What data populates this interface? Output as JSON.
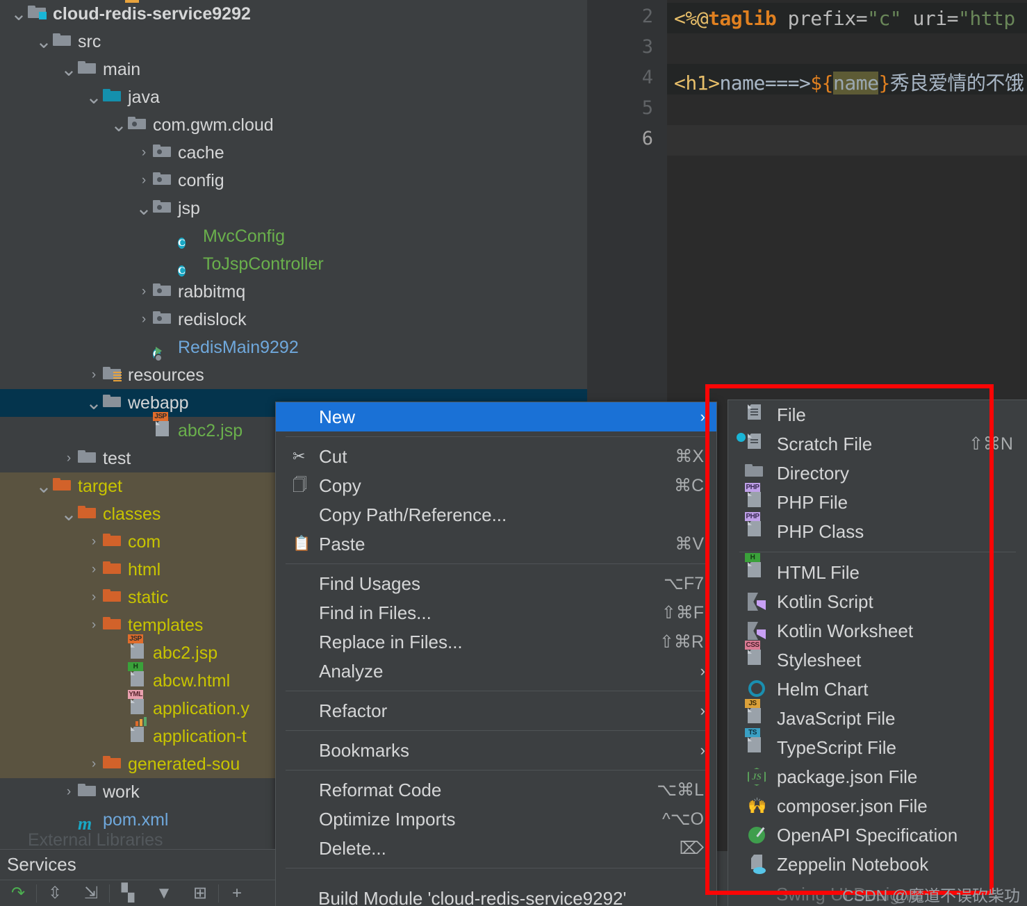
{
  "app": {
    "ide": "IntelliJ IDEA",
    "watermark": "CSDN @魔道不误砍柴功"
  },
  "colors": {
    "accent_selection": "#1a71d6",
    "tree_selected_row": "#04344d",
    "target_folder_bg": "#5a5340",
    "target_folder_text": "#c8c400",
    "annotation_red": "#fb0505",
    "panel_bg": "#3c3f41",
    "editor_bg": "#2b2b2b"
  },
  "project_tree": {
    "items": [
      {
        "label": "cloud-redis-service9292",
        "indent": 0,
        "twisty": "down",
        "icon": "module-folder-icon",
        "style": "bold"
      },
      {
        "label": "src",
        "indent": 1,
        "twisty": "down",
        "icon": "folder-grey-icon",
        "style": "normal"
      },
      {
        "label": "main",
        "indent": 2,
        "twisty": "down",
        "icon": "folder-grey-icon",
        "style": "normal"
      },
      {
        "label": "java",
        "indent": 3,
        "twisty": "down",
        "icon": "folder-blue-source-icon",
        "style": "normal"
      },
      {
        "label": "com.gwm.cloud",
        "indent": 4,
        "twisty": "down",
        "icon": "package-icon",
        "style": "normal"
      },
      {
        "label": "cache",
        "indent": 5,
        "twisty": "right",
        "icon": "package-icon",
        "style": "normal"
      },
      {
        "label": "config",
        "indent": 5,
        "twisty": "right",
        "icon": "package-icon",
        "style": "normal"
      },
      {
        "label": "jsp",
        "indent": 5,
        "twisty": "down",
        "icon": "package-icon",
        "style": "normal"
      },
      {
        "label": "MvcConfig",
        "indent": 6,
        "twisty": "none",
        "icon": "class-icon",
        "style": "green"
      },
      {
        "label": "ToJspController",
        "indent": 6,
        "twisty": "none",
        "icon": "class-icon",
        "style": "green"
      },
      {
        "label": "rabbitmq",
        "indent": 5,
        "twisty": "right",
        "icon": "package-icon",
        "style": "normal"
      },
      {
        "label": "redislock",
        "indent": 5,
        "twisty": "right",
        "icon": "package-icon",
        "style": "normal"
      },
      {
        "label": "RedisMain9292",
        "indent": 5,
        "twisty": "none",
        "icon": "runnable-class-icon",
        "style": "blue"
      },
      {
        "label": "resources",
        "indent": 3,
        "twisty": "right",
        "icon": "resources-folder-icon",
        "style": "normal"
      },
      {
        "label": "webapp",
        "indent": 3,
        "twisty": "down",
        "icon": "folder-grey-icon",
        "style": "normal",
        "selected": true
      },
      {
        "label": "abc2.jsp",
        "indent": 5,
        "twisty": "none",
        "icon": "jsp-file-icon",
        "style": "green"
      },
      {
        "label": "test",
        "indent": 2,
        "twisty": "right",
        "icon": "folder-grey-icon",
        "style": "normal"
      },
      {
        "label": "target",
        "indent": 1,
        "twisty": "down",
        "icon": "folder-orange-icon",
        "style": "excluded"
      },
      {
        "label": "classes",
        "indent": 2,
        "twisty": "down",
        "icon": "folder-orange-icon",
        "style": "excluded"
      },
      {
        "label": "com",
        "indent": 3,
        "twisty": "right",
        "icon": "folder-orange-icon",
        "style": "excluded"
      },
      {
        "label": "html",
        "indent": 3,
        "twisty": "right",
        "icon": "folder-orange-icon",
        "style": "excluded"
      },
      {
        "label": "static",
        "indent": 3,
        "twisty": "right",
        "icon": "folder-orange-icon",
        "style": "excluded"
      },
      {
        "label": "templates",
        "indent": 3,
        "twisty": "right",
        "icon": "folder-orange-icon",
        "style": "excluded"
      },
      {
        "label": "abc2.jsp",
        "indent": 4,
        "twisty": "none",
        "icon": "jsp-file-icon",
        "style": "excluded"
      },
      {
        "label": "abcw.html",
        "indent": 4,
        "twisty": "none",
        "icon": "html-file-icon",
        "style": "excluded"
      },
      {
        "label": "application.y",
        "indent": 4,
        "twisty": "none",
        "icon": "yml-file-icon",
        "style": "excluded"
      },
      {
        "label": "application-t",
        "indent": 4,
        "twisty": "none",
        "icon": "properties-file-icon",
        "style": "excluded"
      },
      {
        "label": "generated-sou",
        "indent": 3,
        "twisty": "right",
        "icon": "folder-orange-icon",
        "style": "excluded"
      },
      {
        "label": "work",
        "indent": 2,
        "twisty": "right",
        "icon": "folder-grey-icon",
        "style": "normal"
      },
      {
        "label": "pom.xml",
        "indent": 2,
        "twisty": "none",
        "icon": "maven-file-icon",
        "style": "blue"
      }
    ],
    "clipped_row": "External Libraries"
  },
  "editor": {
    "line_numbers": [
      "2",
      "3",
      "4",
      "5",
      "6"
    ],
    "current_line": "6",
    "lines": [
      {
        "n": "2",
        "tokens": [
          {
            "t": "<%@",
            "k": "tag"
          },
          {
            "t": "taglib",
            "k": "kw"
          },
          {
            "t": " prefix=",
            "k": "attr"
          },
          {
            "t": "\"c\"",
            "k": "str"
          },
          {
            "t": " uri=",
            "k": "attr"
          },
          {
            "t": "\"http",
            "k": "str"
          }
        ]
      },
      {
        "n": "4",
        "tokens": [
          {
            "t": "<h1>",
            "k": "tag"
          },
          {
            "t": "name===>",
            "k": "plain"
          },
          {
            "t": "${",
            "k": "el"
          },
          {
            "t": "name",
            "k": "elname"
          },
          {
            "t": "}",
            "k": "el"
          },
          {
            "t": "秀良爱情的不饿",
            "k": "cn"
          }
        ]
      }
    ]
  },
  "context_menu": {
    "items": [
      {
        "label": "New",
        "shortcut": "",
        "icon": "",
        "submenu": true,
        "highlighted": true
      },
      {
        "sep": true
      },
      {
        "label": "Cut",
        "shortcut": "⌘X",
        "icon": "scissors-icon"
      },
      {
        "label": "Copy",
        "shortcut": "⌘C",
        "icon": "copy-icon"
      },
      {
        "label": "Copy Path/Reference...",
        "shortcut": "",
        "icon": ""
      },
      {
        "label": "Paste",
        "shortcut": "⌘V",
        "icon": "clipboard-icon"
      },
      {
        "sep": true
      },
      {
        "label": "Find Usages",
        "shortcut": "⌥F7",
        "icon": ""
      },
      {
        "label": "Find in Files...",
        "shortcut": "⇧⌘F",
        "icon": ""
      },
      {
        "label": "Replace in Files...",
        "shortcut": "⇧⌘R",
        "icon": ""
      },
      {
        "label": "Analyze",
        "shortcut": "",
        "icon": "",
        "submenu": true
      },
      {
        "sep": true
      },
      {
        "label": "Refactor",
        "shortcut": "",
        "icon": "",
        "submenu": true
      },
      {
        "sep": true
      },
      {
        "label": "Bookmarks",
        "shortcut": "",
        "icon": "",
        "submenu": true
      },
      {
        "sep": true
      },
      {
        "label": "Reformat Code",
        "shortcut": "⌥⌘L",
        "icon": ""
      },
      {
        "label": "Optimize Imports",
        "shortcut": "^⌥O",
        "icon": ""
      },
      {
        "label": "Delete...",
        "shortcut": "⌦",
        "icon": ""
      },
      {
        "sep": true
      }
    ],
    "clipped_item": "Build Module 'cloud-redis-service9292'"
  },
  "new_submenu": {
    "items": [
      {
        "label": "File",
        "shortcut": "",
        "icon": "file-icon"
      },
      {
        "label": "Scratch File",
        "shortcut": "⇧⌘N",
        "icon": "scratch-file-icon"
      },
      {
        "label": "Directory",
        "shortcut": "",
        "icon": "directory-icon"
      },
      {
        "label": "PHP File",
        "shortcut": "",
        "icon": "php-file-icon"
      },
      {
        "label": "PHP Class",
        "shortcut": "",
        "icon": "php-class-icon"
      },
      {
        "sep": true
      },
      {
        "label": "HTML File",
        "shortcut": "",
        "icon": "html-file-icon"
      },
      {
        "label": "Kotlin Script",
        "shortcut": "",
        "icon": "kotlin-icon"
      },
      {
        "label": "Kotlin Worksheet",
        "shortcut": "",
        "icon": "kotlin-icon"
      },
      {
        "label": "Stylesheet",
        "shortcut": "",
        "icon": "css-file-icon"
      },
      {
        "label": "Helm Chart",
        "shortcut": "",
        "icon": "helm-chart-icon"
      },
      {
        "label": "JavaScript File",
        "shortcut": "",
        "icon": "javascript-file-icon"
      },
      {
        "label": "TypeScript File",
        "shortcut": "",
        "icon": "typescript-file-icon"
      },
      {
        "label": "package.json File",
        "shortcut": "",
        "icon": "nodejs-icon"
      },
      {
        "label": "composer.json File",
        "shortcut": "",
        "icon": "composer-icon"
      },
      {
        "label": "OpenAPI Specification",
        "shortcut": "",
        "icon": "openapi-icon"
      },
      {
        "label": "Zeppelin Notebook",
        "shortcut": "",
        "icon": "zeppelin-icon"
      }
    ],
    "clipped_item": "Swing UI Designer"
  },
  "services_panel": {
    "title": "Services",
    "toolbar_buttons": [
      {
        "name": "rerun-icon",
        "glyph": "↷"
      },
      {
        "name": "expand-all-icon",
        "glyph": "⇳"
      },
      {
        "name": "collapse-all-icon",
        "glyph": "⇲"
      },
      {
        "name": "grid-view-icon",
        "glyph": "▚"
      },
      {
        "name": "filter-icon",
        "glyph": "▼"
      },
      {
        "name": "add-tab-icon",
        "glyph": "⊞"
      },
      {
        "name": "add-icon",
        "glyph": "+"
      }
    ]
  }
}
